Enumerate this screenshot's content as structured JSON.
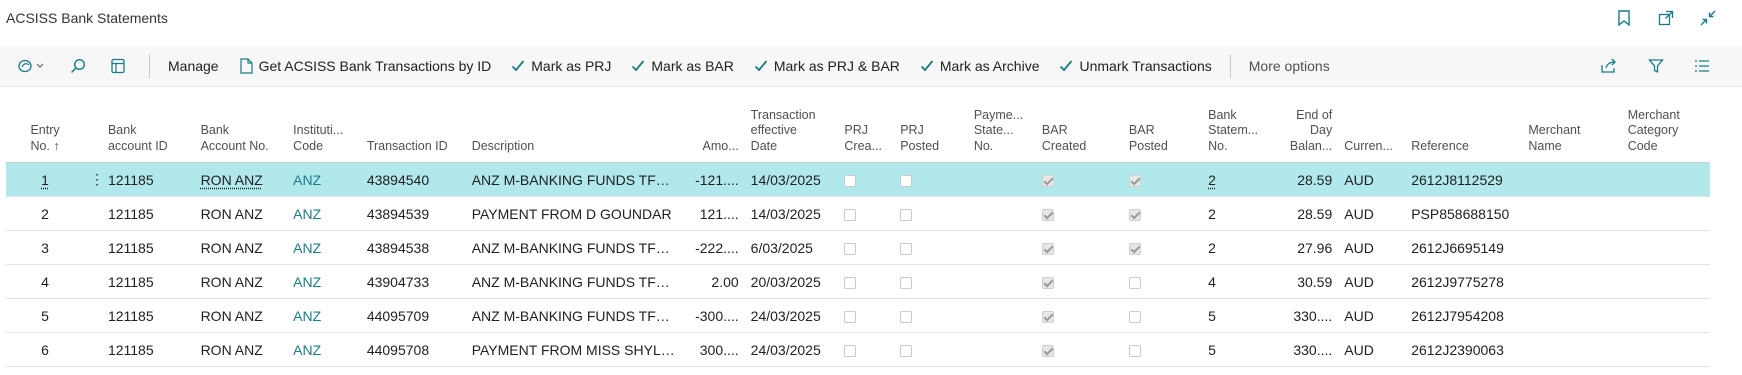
{
  "page": {
    "title": "ACSISS Bank Statements"
  },
  "title_icons": [
    "bookmark-icon",
    "open-in-new-window-icon",
    "collapse-icon"
  ],
  "actions": {
    "manage": "Manage",
    "get_transactions": "Get ACSISS Bank Transactions by ID",
    "mark_prj": "Mark as PRJ",
    "mark_bar": "Mark as BAR",
    "mark_prj_bar": "Mark as PRJ & BAR",
    "mark_archive": "Mark as Archive",
    "unmark": "Unmark Transactions",
    "more": "More options"
  },
  "columns": {
    "entry_no": [
      "Entry",
      "No. ↑"
    ],
    "bank_account_id": [
      "Bank",
      "account ID"
    ],
    "bank_account_no": [
      "Bank",
      "Account No."
    ],
    "institution_code": [
      "Instituti...",
      "Code"
    ],
    "transaction_id": [
      "Transaction ID"
    ],
    "description": [
      "Description"
    ],
    "amount": [
      "Amo..."
    ],
    "effective_date": [
      "Transaction",
      "effective",
      "Date"
    ],
    "prj_created": [
      "PRJ",
      "Crea..."
    ],
    "prj_posted": [
      "PRJ",
      "Posted"
    ],
    "payment_statement_no": [
      "Payme...",
      "State...",
      "No."
    ],
    "bar_created": [
      "BAR",
      "Created"
    ],
    "bar_posted": [
      "BAR",
      "Posted"
    ],
    "bank_statement_no": [
      "Bank",
      "Statem...",
      "No."
    ],
    "eod_balance": [
      "End of",
      "Day",
      "Balan..."
    ],
    "currency": [
      "Curren..."
    ],
    "reference": [
      "Reference"
    ],
    "merchant_name": [
      "Merchant",
      "Name"
    ],
    "merchant_category_code": [
      "Merchant",
      "Category",
      "Code"
    ]
  },
  "rows": [
    {
      "entry_no": "1",
      "bank_account_id": "121185",
      "bank_account_no": "RON ANZ",
      "institution_code": "ANZ",
      "transaction_id": "43894540",
      "description": "ANZ M-BANKING FUNDS TFER ...",
      "amount": "-121....",
      "effective_date": "14/03/2025",
      "prj_created": false,
      "prj_posted": false,
      "payment_statement_no": "",
      "bar_created": true,
      "bar_posted": true,
      "bank_statement_no": "2",
      "eod_balance": "28.59",
      "currency": "AUD",
      "reference": "2612J8112529",
      "merchant_name": "",
      "merchant_category_code": ""
    },
    {
      "entry_no": "2",
      "bank_account_id": "121185",
      "bank_account_no": "RON ANZ",
      "institution_code": "ANZ",
      "transaction_id": "43894539",
      "description": "PAYMENT FROM D GOUNDAR",
      "amount": "121....",
      "effective_date": "14/03/2025",
      "prj_created": false,
      "prj_posted": false,
      "payment_statement_no": "",
      "bar_created": true,
      "bar_posted": true,
      "bank_statement_no": "2",
      "eod_balance": "28.59",
      "currency": "AUD",
      "reference": "PSP858688150",
      "merchant_name": "",
      "merchant_category_code": ""
    },
    {
      "entry_no": "3",
      "bank_account_id": "121185",
      "bank_account_no": "RON ANZ",
      "institution_code": "ANZ",
      "transaction_id": "43894538",
      "description": "ANZ M-BANKING FUNDS TFER ...",
      "amount": "-222....",
      "effective_date": "6/03/2025",
      "prj_created": false,
      "prj_posted": false,
      "payment_statement_no": "",
      "bar_created": true,
      "bar_posted": true,
      "bank_statement_no": "2",
      "eod_balance": "27.96",
      "currency": "AUD",
      "reference": "2612J6695149",
      "merchant_name": "",
      "merchant_category_code": ""
    },
    {
      "entry_no": "4",
      "bank_account_id": "121185",
      "bank_account_no": "RON ANZ",
      "institution_code": "ANZ",
      "transaction_id": "43904733",
      "description": "ANZ M-BANKING FUNDS TFER ...",
      "amount": "2.00",
      "effective_date": "20/03/2025",
      "prj_created": false,
      "prj_posted": false,
      "payment_statement_no": "",
      "bar_created": true,
      "bar_posted": false,
      "bank_statement_no": "4",
      "eod_balance": "30.59",
      "currency": "AUD",
      "reference": "2612J9775278",
      "merchant_name": "",
      "merchant_category_code": ""
    },
    {
      "entry_no": "5",
      "bank_account_id": "121185",
      "bank_account_no": "RON ANZ",
      "institution_code": "ANZ",
      "transaction_id": "44095709",
      "description": "ANZ M-BANKING FUNDS TFER ...",
      "amount": "-300....",
      "effective_date": "24/03/2025",
      "prj_created": false,
      "prj_posted": false,
      "payment_statement_no": "",
      "bar_created": true,
      "bar_posted": false,
      "bank_statement_no": "5",
      "eod_balance": "330....",
      "currency": "AUD",
      "reference": "2612J7954208",
      "merchant_name": "",
      "merchant_category_code": ""
    },
    {
      "entry_no": "6",
      "bank_account_id": "121185",
      "bank_account_no": "RON ANZ",
      "institution_code": "ANZ",
      "transaction_id": "44095708",
      "description": "PAYMENT FROM MISS SHYLAH ...",
      "amount": "300....",
      "effective_date": "24/03/2025",
      "prj_created": false,
      "prj_posted": false,
      "payment_statement_no": "",
      "bar_created": true,
      "bar_posted": false,
      "bank_statement_no": "5",
      "eod_balance": "330....",
      "currency": "AUD",
      "reference": "2612J2390063",
      "merchant_name": "",
      "merchant_category_code": ""
    }
  ],
  "selected_row": 0,
  "colors": {
    "accent": "#1b7b86",
    "selected_row": "#b0e8ec",
    "action_bar": "#f7f7f7"
  }
}
